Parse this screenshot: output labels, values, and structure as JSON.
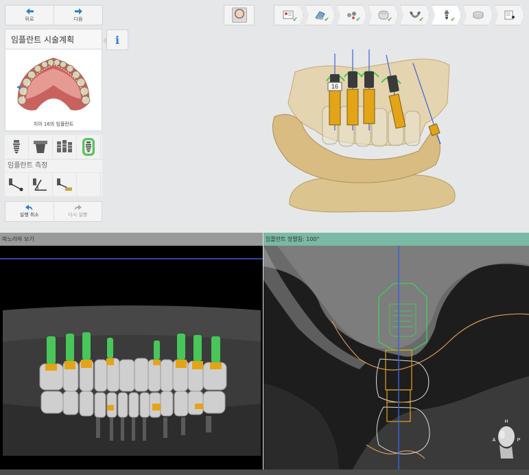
{
  "nav": {
    "back_label": "뒤로",
    "next_label": "다음"
  },
  "steps": [
    {
      "icon": "prescription-icon",
      "done": true
    },
    {
      "icon": "scan-icon",
      "done": true
    },
    {
      "icon": "implants-icon",
      "done": true
    },
    {
      "icon": "crown-icon",
      "done": true
    },
    {
      "icon": "arch-icon",
      "done": true
    },
    {
      "icon": "implant-plan-icon",
      "done": true,
      "active": true
    },
    {
      "icon": "guide-icon",
      "done": false
    },
    {
      "icon": "report-icon",
      "done": false
    }
  ],
  "panel": {
    "title": "임플란트 시술계획",
    "thumbnail_caption": "치아 16의 임플란트",
    "measure_label": "임플란트 측정",
    "undo_label": "실행 취소",
    "redo_label": "다시 실행"
  },
  "viewport3d": {
    "tooth_tag": "16"
  },
  "panorama": {
    "header": "파노라마 보기"
  },
  "cross_section": {
    "header": "임플란트 정렬됨: 100°",
    "orientation_top": "H",
    "orientation_left": "A",
    "orientation_right": "P"
  },
  "colors": {
    "accent_green": "#5cc15c",
    "implant_gold": "#e3a417",
    "sleeve_green": "#48c65a",
    "header_teal": "#7ab9a3",
    "axis_blue": "#3b5fd9",
    "nerve_orange": "#d89a55"
  }
}
